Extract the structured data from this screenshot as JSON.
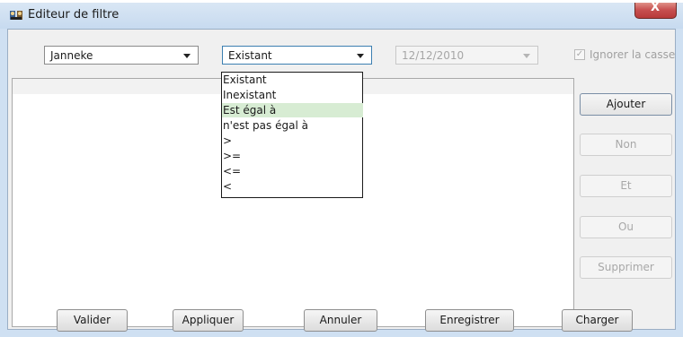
{
  "window": {
    "title": "Editeur de filtre",
    "close_label": "X"
  },
  "filter": {
    "field_value": "Janneke",
    "operator_value": "Existant",
    "date_value": "12/12/2010",
    "ignore_case_label": "Ignorer la casse",
    "ignore_case_checked": true
  },
  "operator_dropdown": {
    "items": [
      {
        "label": "Existant"
      },
      {
        "label": "Inexistant"
      },
      {
        "label": "Est égal à"
      },
      {
        "label": "n'est pas égal à"
      },
      {
        "label": ">"
      },
      {
        "label": ">="
      },
      {
        "label": "<="
      },
      {
        "label": "<"
      }
    ],
    "highlighted_item": "Est égal à"
  },
  "side_buttons": {
    "add": "Ajouter",
    "not": "Non",
    "and": "Et",
    "or": "Ou",
    "delete": "Supprimer"
  },
  "bottom_buttons": {
    "validate": "Valider",
    "apply": "Appliquer",
    "cancel": "Annuler",
    "save": "Enregistrer",
    "load": "Charger"
  },
  "checkmark_glyph": "✓"
}
